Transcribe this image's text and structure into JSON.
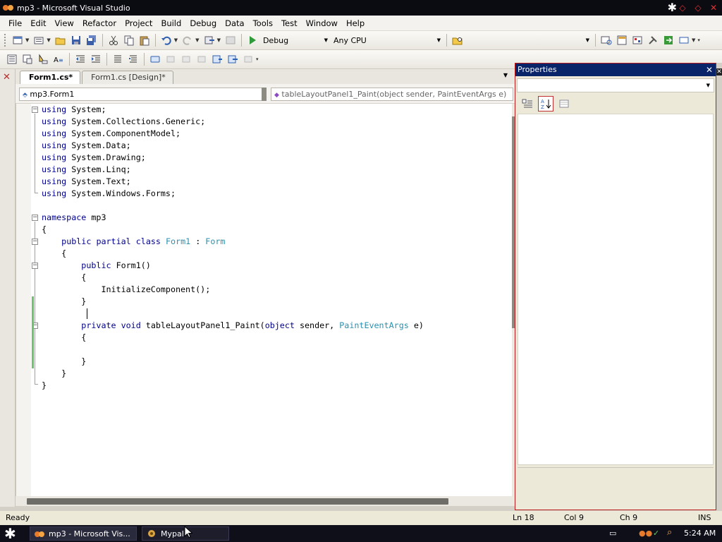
{
  "window": {
    "title": "mp3 - Microsoft Visual Studio"
  },
  "menu": [
    "File",
    "Edit",
    "View",
    "Refactor",
    "Project",
    "Build",
    "Debug",
    "Data",
    "Tools",
    "Test",
    "Window",
    "Help"
  ],
  "toolbar": {
    "config": "Debug",
    "platform": "Any CPU"
  },
  "tabs": [
    {
      "label": "Form1.cs*",
      "active": true
    },
    {
      "label": "Form1.cs [Design]*",
      "active": false
    }
  ],
  "navbar": {
    "class_combo": "mp3.Form1",
    "method_combo": "tableLayoutPanel1_Paint(object sender, PaintEventArgs e)"
  },
  "code": {
    "lines": [
      [
        {
          "t": "using",
          "k": "kw"
        },
        {
          "t": " System;"
        }
      ],
      [
        {
          "t": "using",
          "k": "kw"
        },
        {
          "t": " System.Collections.Generic;"
        }
      ],
      [
        {
          "t": "using",
          "k": "kw"
        },
        {
          "t": " System.ComponentModel;"
        }
      ],
      [
        {
          "t": "using",
          "k": "kw"
        },
        {
          "t": " System.Data;"
        }
      ],
      [
        {
          "t": "using",
          "k": "kw"
        },
        {
          "t": " System.Drawing;"
        }
      ],
      [
        {
          "t": "using",
          "k": "kw"
        },
        {
          "t": " System.Linq;"
        }
      ],
      [
        {
          "t": "using",
          "k": "kw"
        },
        {
          "t": " System.Text;"
        }
      ],
      [
        {
          "t": "using",
          "k": "kw"
        },
        {
          "t": " System.Windows.Forms;"
        }
      ],
      [],
      [
        {
          "t": "namespace",
          "k": "kw"
        },
        {
          "t": " mp3"
        }
      ],
      [
        {
          "t": "{"
        }
      ],
      [
        {
          "t": "    "
        },
        {
          "t": "public",
          "k": "kw"
        },
        {
          "t": " "
        },
        {
          "t": "partial",
          "k": "kw"
        },
        {
          "t": " "
        },
        {
          "t": "class",
          "k": "kw"
        },
        {
          "t": " "
        },
        {
          "t": "Form1",
          "k": "ty"
        },
        {
          "t": " : "
        },
        {
          "t": "Form",
          "k": "ty"
        }
      ],
      [
        {
          "t": "    {"
        }
      ],
      [
        {
          "t": "        "
        },
        {
          "t": "public",
          "k": "kw"
        },
        {
          "t": " Form1()"
        }
      ],
      [
        {
          "t": "        {"
        }
      ],
      [
        {
          "t": "            InitializeComponent();"
        }
      ],
      [
        {
          "t": "        }"
        }
      ],
      [],
      [
        {
          "t": "        "
        },
        {
          "t": "private",
          "k": "kw"
        },
        {
          "t": " "
        },
        {
          "t": "void",
          "k": "kw"
        },
        {
          "t": " tableLayoutPanel1_Paint("
        },
        {
          "t": "object",
          "k": "kw"
        },
        {
          "t": " sender, "
        },
        {
          "t": "PaintEventArgs",
          "k": "ty"
        },
        {
          "t": " e)"
        }
      ],
      [
        {
          "t": "        {"
        }
      ],
      [],
      [
        {
          "t": "        }"
        }
      ],
      [
        {
          "t": "    }"
        }
      ],
      [
        {
          "t": "}"
        }
      ]
    ]
  },
  "properties": {
    "title": "Properties"
  },
  "status": {
    "ready": "Ready",
    "line": "Ln 18",
    "col": "Col 9",
    "ch": "Ch 9",
    "mode": "INS"
  },
  "taskbar": {
    "vs": "mp3 - Microsoft Vis...",
    "mypal": "Mypal",
    "clock": "5:24 AM"
  },
  "colors": {
    "keyword": "#00008b",
    "type": "#2b91af",
    "titlebar": "#0b0b12",
    "panel_title": "#0a246a"
  }
}
